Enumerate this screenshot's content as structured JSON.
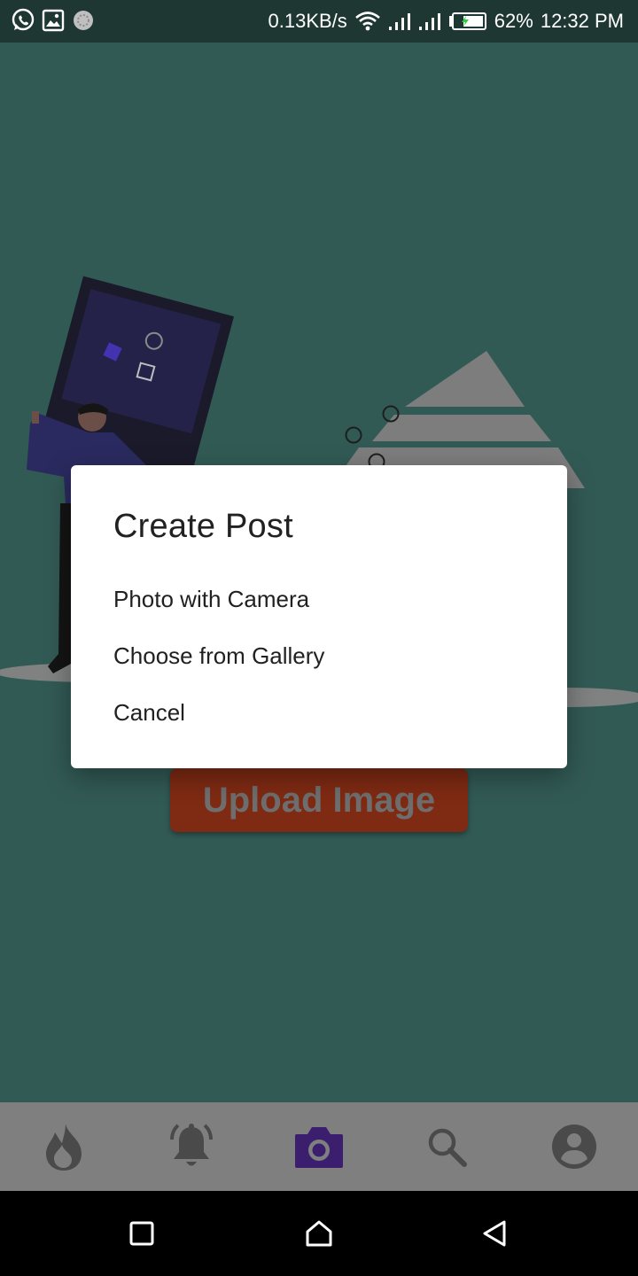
{
  "status_bar": {
    "net_speed": "0.13KB/s",
    "battery": "62%",
    "time": "12:32 PM",
    "icons": [
      "whatsapp-icon",
      "gallery-icon",
      "sync-icon",
      "wifi-icon",
      "signal-icon",
      "signal-icon",
      "battery-icon"
    ]
  },
  "main": {
    "upload_button_label": "Upload Image"
  },
  "dialog": {
    "title": "Create Post",
    "options": [
      {
        "label": "Photo with Camera"
      },
      {
        "label": "Choose from Gallery"
      },
      {
        "label": "Cancel"
      }
    ]
  },
  "bottom_nav": {
    "items": [
      {
        "icon": "flame-icon",
        "active": false
      },
      {
        "icon": "bell-icon",
        "active": false
      },
      {
        "icon": "camera-icon",
        "active": true
      },
      {
        "icon": "search-icon",
        "active": false
      },
      {
        "icon": "account-icon",
        "active": false
      }
    ],
    "active_color": "#3b1f6e",
    "inactive_color": "#4a4a4a"
  },
  "system_nav": {
    "buttons": [
      "recent-apps",
      "home",
      "back"
    ]
  },
  "colors": {
    "app_background": "#325a55",
    "upload_button": "#7f2a13",
    "status_bar": "#1f3733"
  }
}
